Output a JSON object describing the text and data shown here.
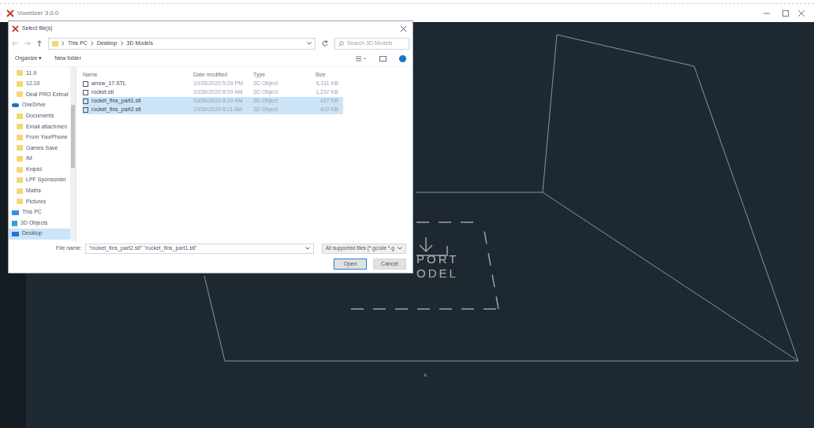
{
  "window": {
    "title": "Voxelizer 3.0.0"
  },
  "dialog": {
    "title": "Select file(s)",
    "breadcrumb": [
      "This PC",
      "Desktop",
      "3D Models"
    ],
    "search": {
      "placeholder": "Search 3D Models"
    },
    "toolbar": [
      "Organize ▾",
      "New folder"
    ],
    "sidebar": [
      {
        "label": "11.9",
        "kind": "folder",
        "selected": false
      },
      {
        "label": "12.10",
        "kind": "folder",
        "selected": false
      },
      {
        "label": "Deal PRO Extrud",
        "kind": "folder",
        "selected": false
      },
      {
        "label": "OneDrive",
        "kind": "cloud",
        "selected": false
      },
      {
        "label": "Documents",
        "kind": "folder",
        "selected": false
      },
      {
        "label": "Email attachmen",
        "kind": "folder",
        "selected": false
      },
      {
        "label": "From YourPhone",
        "kind": "folder",
        "selected": false
      },
      {
        "label": "Games Save",
        "kind": "folder",
        "selected": false
      },
      {
        "label": "IM",
        "kind": "folder",
        "selected": false
      },
      {
        "label": "Kniptd",
        "kind": "folder",
        "selected": false
      },
      {
        "label": "LPF Sponsorder",
        "kind": "folder",
        "selected": false
      },
      {
        "label": "Maths",
        "kind": "folder",
        "selected": false
      },
      {
        "label": "Pictures",
        "kind": "folder",
        "selected": false
      },
      {
        "label": "This PC",
        "kind": "pc",
        "selected": false
      },
      {
        "label": "3D Objects",
        "kind": "cube",
        "selected": false
      },
      {
        "label": "Desktop",
        "kind": "desktop",
        "selected": true
      }
    ],
    "columns": [
      "Name",
      "Date modified",
      "Type",
      "Size"
    ],
    "files": [
      {
        "name": "arrow_17.STL",
        "date": "10/26/2020 5:29 PM",
        "type": "3D Object",
        "size": "5,311 KB",
        "selected": false
      },
      {
        "name": "rocket.stl",
        "date": "10/30/2020 8:09 AM",
        "type": "3D Object",
        "size": "1,237 KB",
        "selected": false
      },
      {
        "name": "rocket_fins_part1.stl",
        "date": "10/30/2020 8:10 AM",
        "type": "3D Object",
        "size": "427 KB",
        "selected": true
      },
      {
        "name": "rocket_fins_part2.stl",
        "date": "10/30/2020 8:11 AM",
        "type": "3D Object",
        "size": "402 KB",
        "selected": true
      }
    ],
    "file_name_label": "File name:",
    "file_name": "\"rocket_fins_part2.stl\" \"rocket_fins_part1.stl\"",
    "file_type": "All supported files (*.gcode *.g",
    "buttons": [
      "Open",
      "Cancel"
    ]
  },
  "import_label": [
    "PORT",
    "ODEL"
  ],
  "canvas_mark": "x"
}
